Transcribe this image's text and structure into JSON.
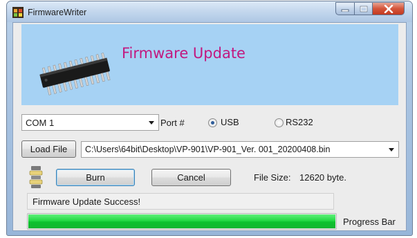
{
  "window": {
    "title": "FirmwareWriter",
    "controls": [
      "minimize-icon",
      "maximize-icon",
      "close-icon"
    ]
  },
  "banner": {
    "title": "Firmware Update",
    "title_color": "#c2187f",
    "background": "#a6d2f4",
    "image": "ic-chip-icon"
  },
  "port": {
    "com_value": "COM 1",
    "port_label": "Port #",
    "usb_label": "USB",
    "rs232_label": "RS232",
    "selected": "USB"
  },
  "file": {
    "load_label": "Load File",
    "path": "C:\\Users\\64bit\\Desktop\\VP-901\\VP-901_Ver. 001_20200408.bin"
  },
  "actions": {
    "burn_label": "Burn",
    "cancel_label": "Cancel",
    "file_size_label": "File Size:",
    "file_size_value": "12620 byte.",
    "side_icon": "chip-stack-icon"
  },
  "status": {
    "message": "Firmware Update Success!"
  },
  "progress": {
    "label": "Progress Bar",
    "value": 1.0,
    "color": "#1ed13b"
  }
}
